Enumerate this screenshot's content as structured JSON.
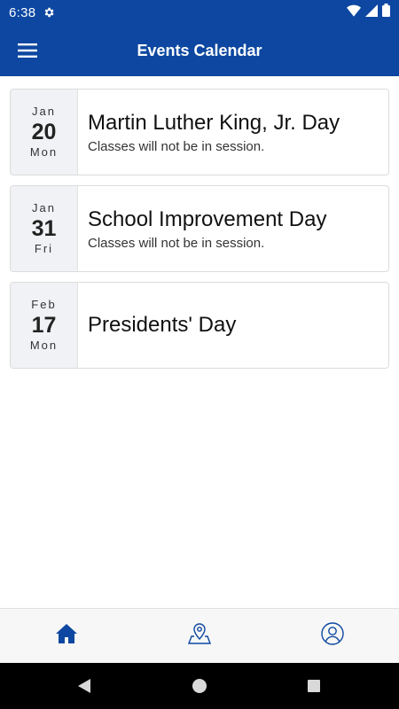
{
  "status_bar": {
    "time": "6:38",
    "icons": [
      "settings-icon",
      "wifi-icon",
      "signal-icon",
      "battery-icon"
    ]
  },
  "app_bar": {
    "title": "Events Calendar",
    "menu_icon": "hamburger-menu-icon",
    "background": "#0d47a1"
  },
  "events": [
    {
      "month": "Jan",
      "day": "20",
      "weekday": "Mon",
      "title": "Martin Luther King, Jr. Day",
      "description": "Classes will not be in session."
    },
    {
      "month": "Jan",
      "day": "31",
      "weekday": "Fri",
      "title": "School Improvement Day",
      "description": "Classes will not be in session."
    },
    {
      "month": "Feb",
      "day": "17",
      "weekday": "Mon",
      "title": "Presidents' Day",
      "description": ""
    }
  ],
  "bottom_nav": {
    "items": [
      {
        "icon": "home-icon",
        "active": true
      },
      {
        "icon": "map-pin-icon",
        "active": false
      },
      {
        "icon": "user-profile-icon",
        "active": false
      }
    ],
    "active_color": "#0d47a1"
  },
  "system_nav": {
    "icons": [
      "back-icon",
      "home-circle-icon",
      "recents-icon"
    ]
  }
}
